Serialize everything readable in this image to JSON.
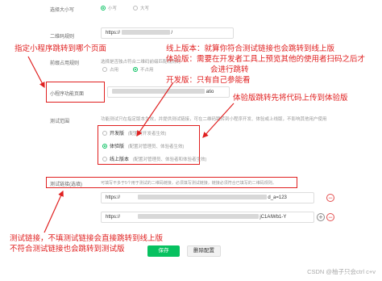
{
  "form": {
    "size_label": "选择大小写",
    "size_options": [
      "小写",
      "大写"
    ],
    "qr_rule_label": "二维码规则",
    "qr_rule_prefix": "https://",
    "qr_rule_suffix": "/",
    "prefix_rule_label": "前缀占用规则",
    "prefix_rule_desc": "选择是否独占符合二维码前缀匹配规则的",
    "prefix_rule_options": [
      "占用",
      "不占用"
    ],
    "page_label": "小程序功能页面",
    "page_value_tail": "atio",
    "test_scope_label": "测试范围",
    "test_scope_desc": "功能测试只在指定版本生效，并提供测试链接，可在二维码跳转到小程序开发、体验或上线版，不影响其他用户使用",
    "versions": [
      {
        "name": "开发版",
        "desc": "(配置对开发者生效)"
      },
      {
        "name": "体验版",
        "desc": "(配置对管理员、体验者生效)"
      },
      {
        "name": "线上版本",
        "desc": "(配置对管理员、体验者和体验者生效)"
      }
    ],
    "test_link_label": "测试链接(选填)",
    "test_link_desc": "可填写不多于5个用于测试的二维码链接，必须填写测试链接，链接必须符合已填写的二维码规则。",
    "links": [
      {
        "prefix": "https://",
        "tail": "d_a=123"
      },
      {
        "prefix": "https://",
        "tail": "jC1AIWb1-Y"
      }
    ],
    "save_label": "保存",
    "delete_label": "删除配置"
  },
  "annotations": {
    "mini_page": "指定小程序跳转到哪个页面",
    "versions_info": [
      "线上版本：就算你符合测试链接也会跳转到线上版",
      "体验版：需要在开发者工具上预览其他的使用者扫码之后才",
      "会进行跳转",
      "开发版：只有自己参能看"
    ],
    "exp_jump": "体验版跳转先将代码上传到体验版",
    "test_rule": [
      "测试链接，不填测试链接会直接跳转到线上版",
      "不符合测试链接也会跳转到测试版"
    ]
  },
  "watermark": "CSDN @柚子只会ctrl c+v",
  "colors": {
    "accent": "#07c160",
    "annotation": "#e02020"
  }
}
